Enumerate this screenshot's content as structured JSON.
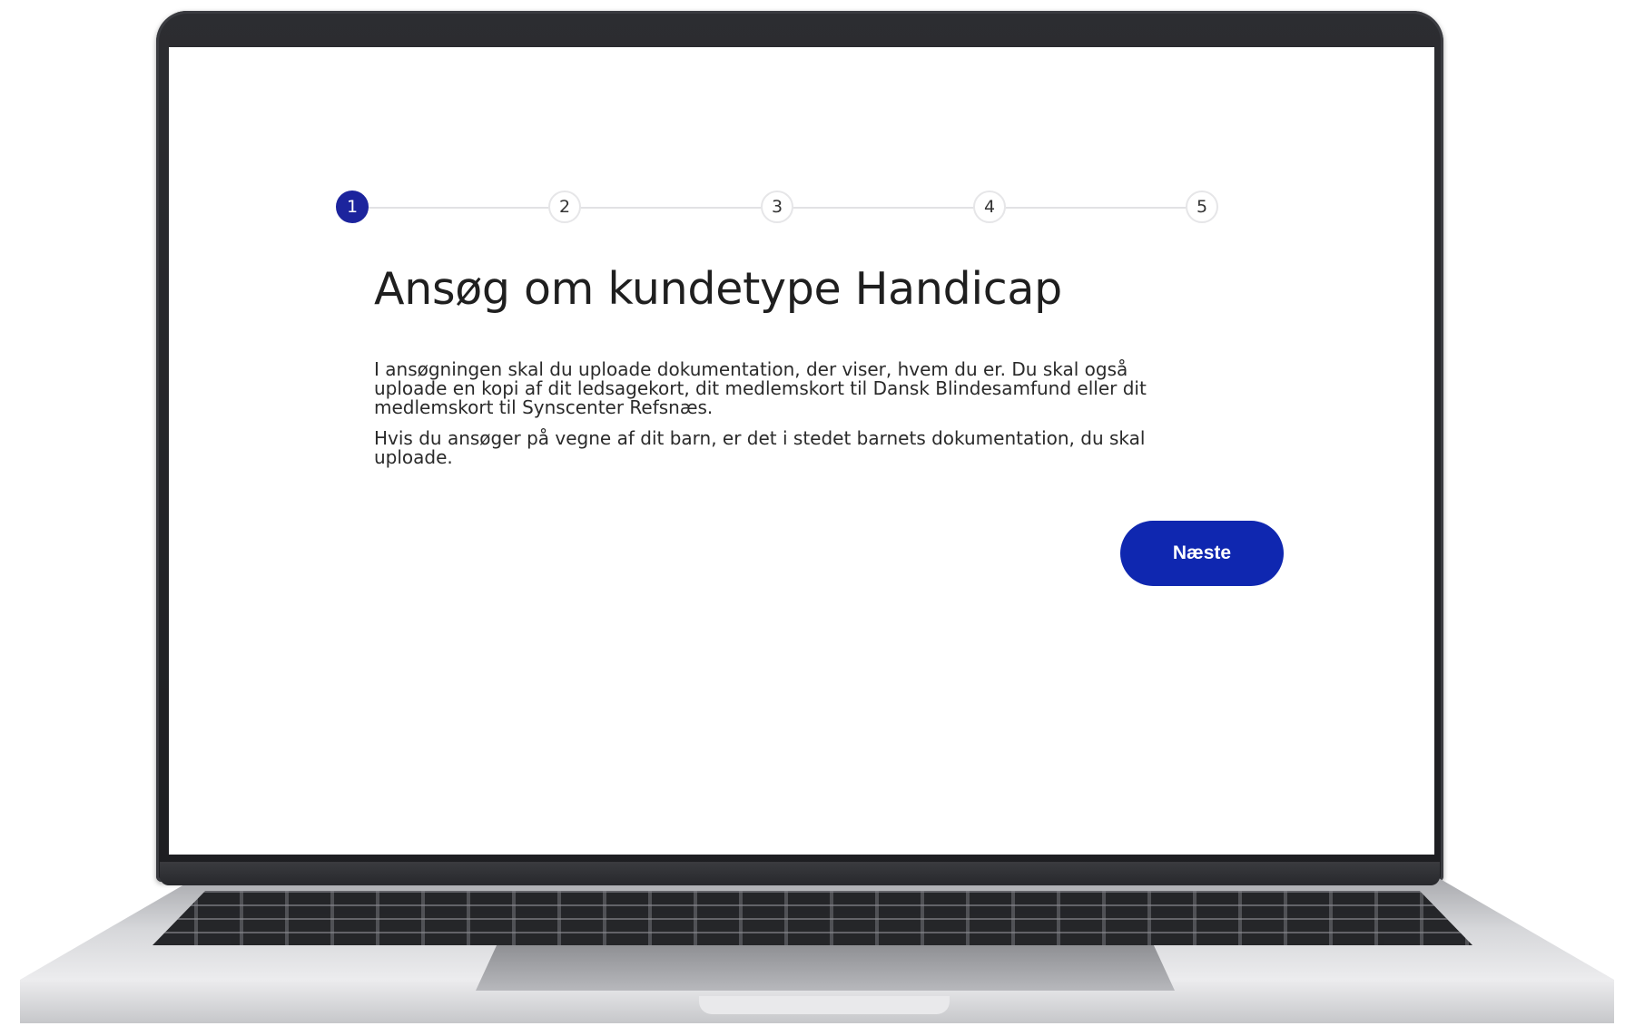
{
  "stepper": {
    "steps": [
      "1",
      "2",
      "3",
      "4",
      "5"
    ],
    "current_step": 1,
    "active_color": "#1c249d"
  },
  "page": {
    "title": "Ansøg om kundetype Handicap",
    "paragraphs": [
      "I ansøgningen skal du uploade dokumentation, der viser, hvem du er. Du skal også uploade en kopi af dit ledsagekort, dit medlemskort til Dansk Blindesamfund eller dit medlemskort til Synscenter Refsnæs.",
      "Hvis du ansøger på vegne af dit barn, er det i stedet barnets dokumentation, du skal uploade."
    ]
  },
  "actions": {
    "next_label": "Næste",
    "button_color": "#0f27b0"
  }
}
